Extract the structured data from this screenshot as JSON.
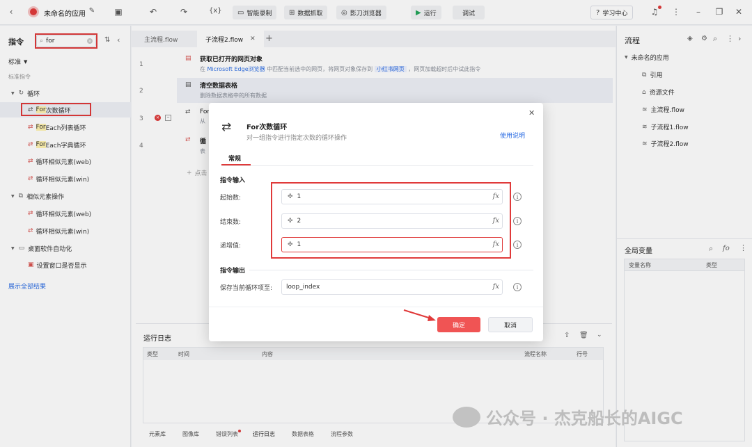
{
  "app": {
    "title": "未命名的应用",
    "study_center": "学习中心"
  },
  "toolbar": {
    "record": "智能录制",
    "data_capture": "数据抓取",
    "browser": "影刀浏览器",
    "run": "运行",
    "debug": "调试"
  },
  "left": {
    "title": "指令",
    "search_value": "for",
    "filter": "标准",
    "section": "标准指令",
    "tree": [
      {
        "label": "循环",
        "kind": "group"
      },
      {
        "label_hl": "For",
        "label_rest": "次数循环",
        "kind": "item"
      },
      {
        "label_hl": "For",
        "label_rest": "Each列表循环",
        "kind": "item"
      },
      {
        "label_hl": "For",
        "label_rest": "Each字典循环",
        "kind": "item"
      },
      {
        "label": "循环相似元素(web)",
        "kind": "item"
      },
      {
        "label": "循环相似元素(win)",
        "kind": "item"
      },
      {
        "label": "相似元素操作",
        "kind": "group"
      },
      {
        "label": "循环相似元素(web)",
        "kind": "item"
      },
      {
        "label": "循环相似元素(win)",
        "kind": "item"
      },
      {
        "label": "桌面软件自动化",
        "kind": "group"
      },
      {
        "label": "设置窗口是否显示",
        "kind": "item"
      }
    ],
    "show_all": "展示全部结果"
  },
  "tabs": [
    {
      "label": "主流程.flow"
    },
    {
      "label": "子流程2.flow"
    }
  ],
  "steps": {
    "s1": {
      "num": "1",
      "title": "获取已打开的网页对象",
      "desc_a": "在",
      "desc_link1": "Microsoft Edge浏览器",
      "desc_b": "中匹配当前选中的网页，将网页对象保存到",
      "desc_tag": "小红书网页",
      "desc_c": "，网页加载超时后中试此指令"
    },
    "s2": {
      "num": "2",
      "title": "清空数据表格",
      "desc": "删除数据表格中的所有数据"
    },
    "s3": {
      "num": "3",
      "title": "For",
      "desc": "从"
    },
    "s4": {
      "num": "4",
      "title": "循",
      "desc": "表"
    },
    "add": "点击"
  },
  "log": {
    "title": "运行日志",
    "columns": [
      "类型",
      "时间",
      "内容",
      "流程名称",
      "行号"
    ],
    "bottom_tabs": [
      "元素库",
      "图像库",
      "错误列表",
      "运行日志",
      "数据表格",
      "流程参数"
    ]
  },
  "right": {
    "title": "流程",
    "root": "未命名的应用",
    "items": [
      "引用",
      "资源文件",
      "主流程.flow",
      "子流程1.flow",
      "子流程2.flow"
    ],
    "globals_title": "全局变量",
    "globals_cols": [
      "变量名称",
      "类型"
    ]
  },
  "dialog": {
    "title": "For次数循环",
    "subtitle": "对一组指令进行指定次数的循环操作",
    "help": "使用说明",
    "tab": "常规",
    "input_section": "指令输入",
    "start_label": "起始数:",
    "start_value": "1",
    "end_label": "结束数:",
    "end_value": "2",
    "step_label": "递增值:",
    "step_value": "1",
    "output_section": "指令输出",
    "save_label": "保存当前循环项至:",
    "save_value": "loop_index",
    "ok": "确定",
    "cancel": "取消"
  },
  "watermark": "公众号 · 杰克船长的AIGC",
  "colors": {
    "accent": "#2f6fe4",
    "danger": "#f05454",
    "highlight": "#e03a3a",
    "run_green": "#23a55a"
  }
}
